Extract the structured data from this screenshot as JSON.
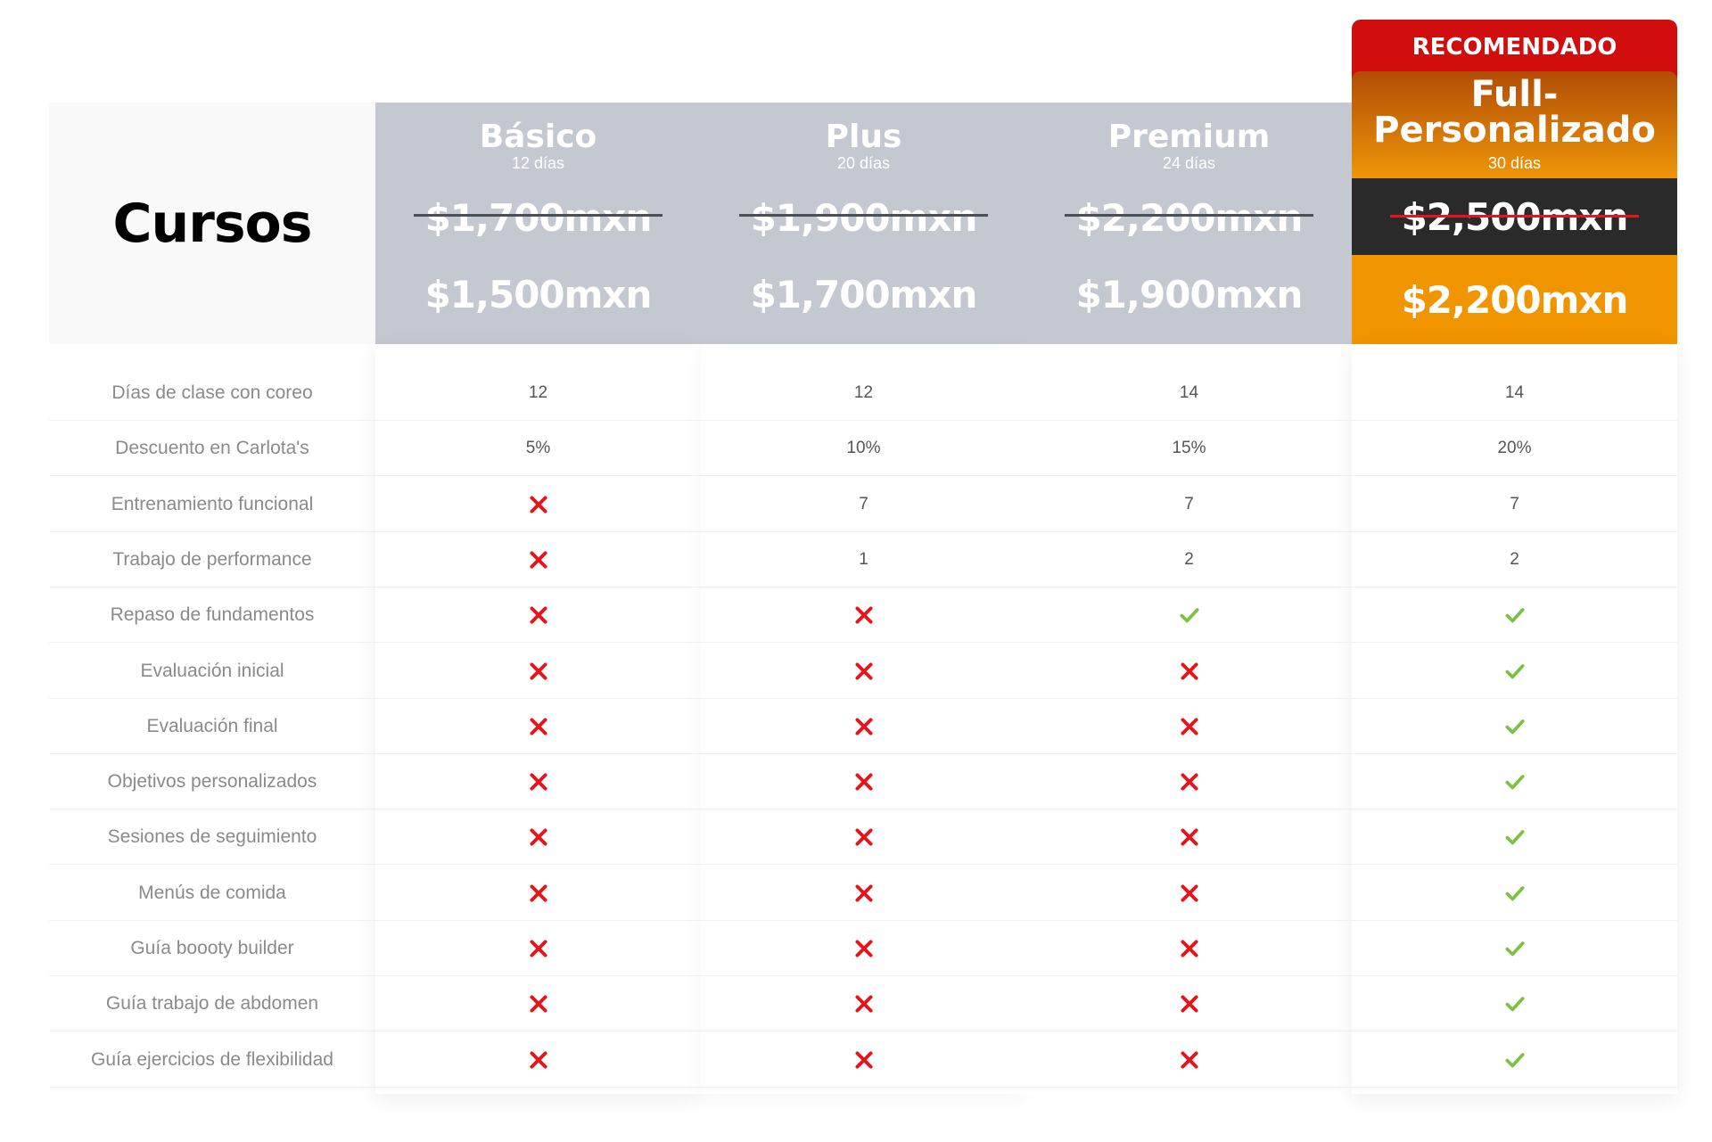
{
  "title": "Cursos",
  "badge": "RECOMENDADO",
  "plans": [
    {
      "name": "Básico",
      "days": "12 días",
      "old_price": "$1,700mxn",
      "new_price": "$1,500mxn"
    },
    {
      "name": "Plus",
      "days": "20 días",
      "old_price": "$1,900mxn",
      "new_price": "$1,700mxn"
    },
    {
      "name": "Premium",
      "days": "24 días",
      "old_price": "$2,200mxn",
      "new_price": "$1,900mxn"
    },
    {
      "name": "Full-Personalizado",
      "name_line1": "Full-",
      "name_line2": "Personalizado",
      "days": "30 días",
      "old_price": "$2,500mxn",
      "new_price": "$2,200mxn"
    }
  ],
  "colors": {
    "header_gray": "#c3c8d1",
    "badge_red": "#d10d0d",
    "accent_orange": "#f09400",
    "dark_band": "#2a2a2a",
    "cross_red": "#e8141c",
    "check_green": "#7dc142"
  },
  "features": [
    {
      "label": "Días de clase con coreo",
      "values": [
        "12",
        "12",
        "14",
        "14"
      ]
    },
    {
      "label": "Descuento en Carlota's",
      "values": [
        "5%",
        "10%",
        "15%",
        "20%"
      ]
    },
    {
      "label": "Entrenamiento funcional",
      "values": [
        "x-icon",
        "7",
        "7",
        "7"
      ]
    },
    {
      "label": "Trabajo de performance",
      "values": [
        "x-icon",
        "1",
        "2",
        "2"
      ]
    },
    {
      "label": "Repaso de fundamentos",
      "values": [
        "x-icon",
        "x-icon",
        "check-icon",
        "check-icon"
      ]
    },
    {
      "label": "Evaluación inicial",
      "values": [
        "x-icon",
        "x-icon",
        "x-icon",
        "check-icon"
      ]
    },
    {
      "label": "Evaluación final",
      "values": [
        "x-icon",
        "x-icon",
        "x-icon",
        "check-icon"
      ]
    },
    {
      "label": "Objetivos personalizados",
      "values": [
        "x-icon",
        "x-icon",
        "x-icon",
        "check-icon"
      ]
    },
    {
      "label": "Sesiones de seguimiento",
      "values": [
        "x-icon",
        "x-icon",
        "x-icon",
        "check-icon"
      ]
    },
    {
      "label": "Menús de comida",
      "values": [
        "x-icon",
        "x-icon",
        "x-icon",
        "check-icon"
      ]
    },
    {
      "label": "Guía boooty builder",
      "values": [
        "x-icon",
        "x-icon",
        "x-icon",
        "check-icon"
      ]
    },
    {
      "label": "Guía trabajo de abdomen",
      "values": [
        "x-icon",
        "x-icon",
        "x-icon",
        "check-icon"
      ]
    },
    {
      "label": "Guía ejercicios de flexibilidad",
      "values": [
        "x-icon",
        "x-icon",
        "x-icon",
        "check-icon"
      ]
    }
  ]
}
